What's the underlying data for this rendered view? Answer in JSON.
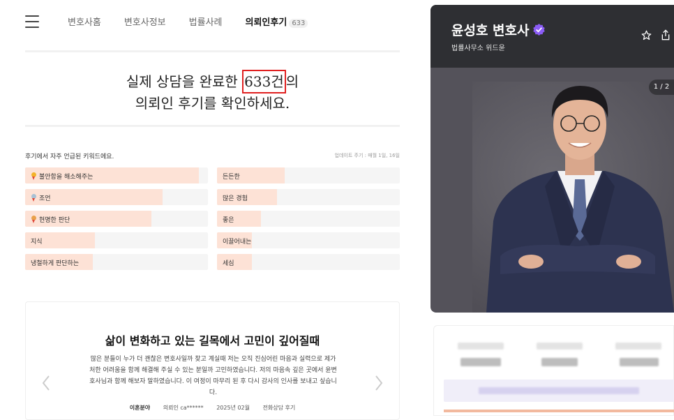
{
  "nav": {
    "tabs": [
      {
        "label": "변호사홈"
      },
      {
        "label": "변호사정보"
      },
      {
        "label": "법률사례"
      },
      {
        "label": "의뢰인후기",
        "count": "633"
      }
    ]
  },
  "headline": {
    "line1_prefix": "실제 상담을 완료한 ",
    "highlight": "633건",
    "line1_suffix": "의",
    "line2": "의뢰인 후기를 확인하세요."
  },
  "keywords": {
    "title": "후기에서 자주 언급된 키워드에요.",
    "update_note": "업데이트 주기 : 매월 1일, 16일",
    "items": [
      {
        "label": "불안함을 해소해주는",
        "fill": 0.95,
        "badge": "gold",
        "badge_color": "#f3b32a"
      },
      {
        "label": "든든한",
        "fill": 0.37
      },
      {
        "label": "조언",
        "fill": 0.75,
        "badge": "silver",
        "badge_color": "#a9c1d4"
      },
      {
        "label": "많은 경험",
        "fill": 0.33
      },
      {
        "label": "현명한 판단",
        "fill": 0.69,
        "badge": "bronze",
        "badge_color": "#e9a14a"
      },
      {
        "label": "좋은",
        "fill": 0.24
      },
      {
        "label": "지식",
        "fill": 0.38
      },
      {
        "label": "이끌어내는",
        "fill": 0.19
      },
      {
        "label": "냉철하게 판단하는",
        "fill": 0.37
      },
      {
        "label": "세심",
        "fill": 0.19
      }
    ]
  },
  "review": {
    "title": "삶이 변화하고 있는 길목에서 고민이 깊어질때",
    "body": "많은 분들이 누가 더 괜찮은 변호사일까 찾고 계실때 저는 오직 진심어린 마음과 실력으로 제가 처한 어려움을 함께 해결해 주실 수 있는 분일까 고민하였습니다. 저의 마음속 깊은 곳에서 윤변호사님과 함께 해보자 말하였습니다. 이 여정이 마무리 된 후 다시 감사의 인사를 보내고 싶습니다.",
    "category": "이혼분야",
    "client": "의뢰인 ca******",
    "date": "2025년 02월",
    "type": "전화상담 후기"
  },
  "profile": {
    "name": "윤성호 변호사",
    "firm": "법률사무소 위드윤",
    "page_indicator": "1 / 2",
    "colors": {
      "header_bg": "#2e2f33",
      "photo_bg": "#54525a",
      "verify": "#8b5cf6"
    }
  }
}
